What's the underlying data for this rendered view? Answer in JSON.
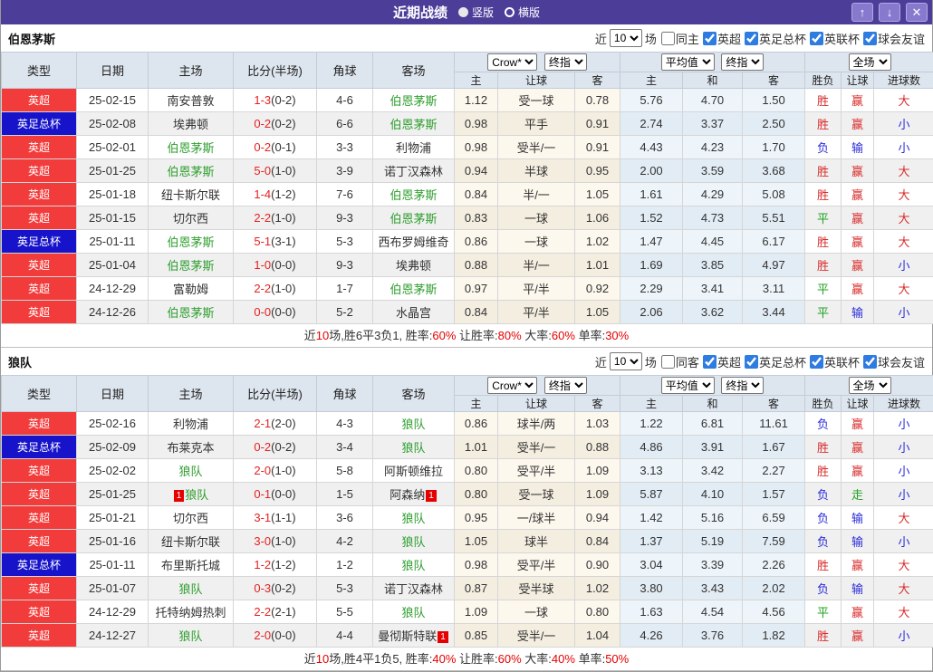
{
  "titlebar": {
    "title": "近期战绩",
    "radios": [
      {
        "label": "竖版",
        "selected": true
      },
      {
        "label": "横版",
        "selected": false
      }
    ],
    "icons": {
      "up": "↑",
      "down": "↓",
      "close": "✕"
    }
  },
  "colors": {
    "titlebar_bg": "#4c3d99",
    "league_red": "#f23b3b",
    "league_blue": "#1713ca",
    "team_green": "#2e9e2e",
    "score_red": "#e62222",
    "win_red": "#d92b2b",
    "lose_blue": "#2b2bd9",
    "draw_green": "#22a022"
  },
  "filters": {
    "near_label": "近",
    "count_value": "10",
    "unit_label": "场",
    "leagues": [
      "英超",
      "英足总杯",
      "英联杯",
      "球会友谊"
    ]
  },
  "table_header": {
    "static_cols": [
      "类型",
      "日期",
      "主场",
      "比分(半场)",
      "角球",
      "客场"
    ],
    "odds_selects": [
      "Crow*",
      "终指"
    ],
    "odds_cols": [
      "主",
      "让球",
      "客"
    ],
    "avg_selects": [
      "平均值",
      "终指"
    ],
    "avg_cols": [
      "主",
      "和",
      "客"
    ],
    "result_selects": [
      "全场"
    ],
    "result_cols": [
      "胜负",
      "让球",
      "进球数"
    ]
  },
  "red_card": {
    "label": "1"
  },
  "sections": [
    {
      "team": "伯恩茅斯",
      "same_venue_label": "同主",
      "rows": [
        {
          "league": "英超",
          "league_type": "red",
          "date": "25-02-15",
          "home": "南安普敦",
          "home_green": false,
          "home_card": false,
          "ft": "1-3",
          "ht": "(0-2)",
          "corner": "4-6",
          "away": "伯恩茅斯",
          "away_green": true,
          "away_card": false,
          "crow": [
            "1.12",
            "受一球",
            "0.78"
          ],
          "avg": [
            "5.76",
            "4.70",
            "1.50"
          ],
          "outcome": [
            "胜",
            "red"
          ],
          "handicap": [
            "赢",
            "red"
          ],
          "goals": [
            "大",
            "red"
          ]
        },
        {
          "league": "英足总杯",
          "league_type": "blue",
          "date": "25-02-08",
          "home": "埃弗顿",
          "home_green": false,
          "home_card": false,
          "ft": "0-2",
          "ht": "(0-2)",
          "corner": "6-6",
          "away": "伯恩茅斯",
          "away_green": true,
          "away_card": false,
          "crow": [
            "0.98",
            "平手",
            "0.91"
          ],
          "avg": [
            "2.74",
            "3.37",
            "2.50"
          ],
          "outcome": [
            "胜",
            "red"
          ],
          "handicap": [
            "赢",
            "red"
          ],
          "goals": [
            "小",
            "blue"
          ]
        },
        {
          "league": "英超",
          "league_type": "red",
          "date": "25-02-01",
          "home": "伯恩茅斯",
          "home_green": true,
          "home_card": false,
          "ft": "0-2",
          "ht": "(0-1)",
          "corner": "3-3",
          "away": "利物浦",
          "away_green": false,
          "away_card": false,
          "crow": [
            "0.98",
            "受半/一",
            "0.91"
          ],
          "avg": [
            "4.43",
            "4.23",
            "1.70"
          ],
          "outcome": [
            "负",
            "blue"
          ],
          "handicap": [
            "输",
            "blue"
          ],
          "goals": [
            "小",
            "blue"
          ]
        },
        {
          "league": "英超",
          "league_type": "red",
          "date": "25-01-25",
          "home": "伯恩茅斯",
          "home_green": true,
          "home_card": false,
          "ft": "5-0",
          "ht": "(1-0)",
          "corner": "3-9",
          "away": "诺丁汉森林",
          "away_green": false,
          "away_card": false,
          "crow": [
            "0.94",
            "半球",
            "0.95"
          ],
          "avg": [
            "2.00",
            "3.59",
            "3.68"
          ],
          "outcome": [
            "胜",
            "red"
          ],
          "handicap": [
            "赢",
            "red"
          ],
          "goals": [
            "大",
            "red"
          ]
        },
        {
          "league": "英超",
          "league_type": "red",
          "date": "25-01-18",
          "home": "纽卡斯尔联",
          "home_green": false,
          "home_card": false,
          "ft": "1-4",
          "ht": "(1-2)",
          "corner": "7-6",
          "away": "伯恩茅斯",
          "away_green": true,
          "away_card": false,
          "crow": [
            "0.84",
            "半/一",
            "1.05"
          ],
          "avg": [
            "1.61",
            "4.29",
            "5.08"
          ],
          "outcome": [
            "胜",
            "red"
          ],
          "handicap": [
            "赢",
            "red"
          ],
          "goals": [
            "大",
            "red"
          ]
        },
        {
          "league": "英超",
          "league_type": "red",
          "date": "25-01-15",
          "home": "切尔西",
          "home_green": false,
          "home_card": false,
          "ft": "2-2",
          "ht": "(1-0)",
          "corner": "9-3",
          "away": "伯恩茅斯",
          "away_green": true,
          "away_card": false,
          "crow": [
            "0.83",
            "一球",
            "1.06"
          ],
          "avg": [
            "1.52",
            "4.73",
            "5.51"
          ],
          "outcome": [
            "平",
            "green"
          ],
          "handicap": [
            "赢",
            "red"
          ],
          "goals": [
            "大",
            "red"
          ]
        },
        {
          "league": "英足总杯",
          "league_type": "blue",
          "date": "25-01-11",
          "home": "伯恩茅斯",
          "home_green": true,
          "home_card": false,
          "ft": "5-1",
          "ht": "(3-1)",
          "corner": "5-3",
          "away": "西布罗姆维奇",
          "away_green": false,
          "away_card": false,
          "crow": [
            "0.86",
            "一球",
            "1.02"
          ],
          "avg": [
            "1.47",
            "4.45",
            "6.17"
          ],
          "outcome": [
            "胜",
            "red"
          ],
          "handicap": [
            "赢",
            "red"
          ],
          "goals": [
            "大",
            "red"
          ]
        },
        {
          "league": "英超",
          "league_type": "red",
          "date": "25-01-04",
          "home": "伯恩茅斯",
          "home_green": true,
          "home_card": false,
          "ft": "1-0",
          "ht": "(0-0)",
          "corner": "9-3",
          "away": "埃弗顿",
          "away_green": false,
          "away_card": false,
          "crow": [
            "0.88",
            "半/一",
            "1.01"
          ],
          "avg": [
            "1.69",
            "3.85",
            "4.97"
          ],
          "outcome": [
            "胜",
            "red"
          ],
          "handicap": [
            "赢",
            "red"
          ],
          "goals": [
            "小",
            "blue"
          ]
        },
        {
          "league": "英超",
          "league_type": "red",
          "date": "24-12-29",
          "home": "富勒姆",
          "home_green": false,
          "home_card": false,
          "ft": "2-2",
          "ht": "(1-0)",
          "corner": "1-7",
          "away": "伯恩茅斯",
          "away_green": true,
          "away_card": false,
          "crow": [
            "0.97",
            "平/半",
            "0.92"
          ],
          "avg": [
            "2.29",
            "3.41",
            "3.11"
          ],
          "outcome": [
            "平",
            "green"
          ],
          "handicap": [
            "赢",
            "red"
          ],
          "goals": [
            "大",
            "red"
          ]
        },
        {
          "league": "英超",
          "league_type": "red",
          "date": "24-12-26",
          "home": "伯恩茅斯",
          "home_green": true,
          "home_card": false,
          "ft": "0-0",
          "ht": "(0-0)",
          "corner": "5-2",
          "away": "水晶宫",
          "away_green": false,
          "away_card": false,
          "crow": [
            "0.84",
            "平/半",
            "1.05"
          ],
          "avg": [
            "2.06",
            "3.62",
            "3.44"
          ],
          "outcome": [
            "平",
            "green"
          ],
          "handicap": [
            "输",
            "blue"
          ],
          "goals": [
            "小",
            "blue"
          ]
        }
      ],
      "summary": [
        {
          "text": "近",
          "red": false
        },
        {
          "text": "10",
          "red": true
        },
        {
          "text": "场,胜6平3负1, 胜率:",
          "red": false
        },
        {
          "text": "60%",
          "red": true
        },
        {
          "text": " 让胜率:",
          "red": false
        },
        {
          "text": "80%",
          "red": true
        },
        {
          "text": " 大率:",
          "red": false
        },
        {
          "text": "60%",
          "red": true
        },
        {
          "text": " 单率:",
          "red": false
        },
        {
          "text": "30%",
          "red": true
        }
      ]
    },
    {
      "team": "狼队",
      "same_venue_label": "同客",
      "rows": [
        {
          "league": "英超",
          "league_type": "red",
          "date": "25-02-16",
          "home": "利物浦",
          "home_green": false,
          "home_card": false,
          "ft": "2-1",
          "ht": "(2-0)",
          "corner": "4-3",
          "away": "狼队",
          "away_green": true,
          "away_card": false,
          "crow": [
            "0.86",
            "球半/两",
            "1.03"
          ],
          "avg": [
            "1.22",
            "6.81",
            "11.61"
          ],
          "outcome": [
            "负",
            "blue"
          ],
          "handicap": [
            "赢",
            "red"
          ],
          "goals": [
            "小",
            "blue"
          ]
        },
        {
          "league": "英足总杯",
          "league_type": "blue",
          "date": "25-02-09",
          "home": "布莱克本",
          "home_green": false,
          "home_card": false,
          "ft": "0-2",
          "ht": "(0-2)",
          "corner": "3-4",
          "away": "狼队",
          "away_green": true,
          "away_card": false,
          "crow": [
            "1.01",
            "受半/一",
            "0.88"
          ],
          "avg": [
            "4.86",
            "3.91",
            "1.67"
          ],
          "outcome": [
            "胜",
            "red"
          ],
          "handicap": [
            "赢",
            "red"
          ],
          "goals": [
            "小",
            "blue"
          ]
        },
        {
          "league": "英超",
          "league_type": "red",
          "date": "25-02-02",
          "home": "狼队",
          "home_green": true,
          "home_card": false,
          "ft": "2-0",
          "ht": "(1-0)",
          "corner": "5-8",
          "away": "阿斯顿维拉",
          "away_green": false,
          "away_card": false,
          "crow": [
            "0.80",
            "受平/半",
            "1.09"
          ],
          "avg": [
            "3.13",
            "3.42",
            "2.27"
          ],
          "outcome": [
            "胜",
            "red"
          ],
          "handicap": [
            "赢",
            "red"
          ],
          "goals": [
            "小",
            "blue"
          ]
        },
        {
          "league": "英超",
          "league_type": "red",
          "date": "25-01-25",
          "home": "狼队",
          "home_green": true,
          "home_card": true,
          "ft": "0-1",
          "ht": "(0-0)",
          "corner": "1-5",
          "away": "阿森纳",
          "away_green": false,
          "away_card": true,
          "crow": [
            "0.80",
            "受一球",
            "1.09"
          ],
          "avg": [
            "5.87",
            "4.10",
            "1.57"
          ],
          "outcome": [
            "负",
            "blue"
          ],
          "handicap": [
            "走",
            "green"
          ],
          "goals": [
            "小",
            "blue"
          ]
        },
        {
          "league": "英超",
          "league_type": "red",
          "date": "25-01-21",
          "home": "切尔西",
          "home_green": false,
          "home_card": false,
          "ft": "3-1",
          "ht": "(1-1)",
          "corner": "3-6",
          "away": "狼队",
          "away_green": true,
          "away_card": false,
          "crow": [
            "0.95",
            "一/球半",
            "0.94"
          ],
          "avg": [
            "1.42",
            "5.16",
            "6.59"
          ],
          "outcome": [
            "负",
            "blue"
          ],
          "handicap": [
            "输",
            "blue"
          ],
          "goals": [
            "大",
            "red"
          ]
        },
        {
          "league": "英超",
          "league_type": "red",
          "date": "25-01-16",
          "home": "纽卡斯尔联",
          "home_green": false,
          "home_card": false,
          "ft": "3-0",
          "ht": "(1-0)",
          "corner": "4-2",
          "away": "狼队",
          "away_green": true,
          "away_card": false,
          "crow": [
            "1.05",
            "球半",
            "0.84"
          ],
          "avg": [
            "1.37",
            "5.19",
            "7.59"
          ],
          "outcome": [
            "负",
            "blue"
          ],
          "handicap": [
            "输",
            "blue"
          ],
          "goals": [
            "小",
            "blue"
          ]
        },
        {
          "league": "英足总杯",
          "league_type": "blue",
          "date": "25-01-11",
          "home": "布里斯托城",
          "home_green": false,
          "home_card": false,
          "ft": "1-2",
          "ht": "(1-2)",
          "corner": "1-2",
          "away": "狼队",
          "away_green": true,
          "away_card": false,
          "crow": [
            "0.98",
            "受平/半",
            "0.90"
          ],
          "avg": [
            "3.04",
            "3.39",
            "2.26"
          ],
          "outcome": [
            "胜",
            "red"
          ],
          "handicap": [
            "赢",
            "red"
          ],
          "goals": [
            "大",
            "red"
          ]
        },
        {
          "league": "英超",
          "league_type": "red",
          "date": "25-01-07",
          "home": "狼队",
          "home_green": true,
          "home_card": false,
          "ft": "0-3",
          "ht": "(0-2)",
          "corner": "5-3",
          "away": "诺丁汉森林",
          "away_green": false,
          "away_card": false,
          "crow": [
            "0.87",
            "受半球",
            "1.02"
          ],
          "avg": [
            "3.80",
            "3.43",
            "2.02"
          ],
          "outcome": [
            "负",
            "blue"
          ],
          "handicap": [
            "输",
            "blue"
          ],
          "goals": [
            "大",
            "red"
          ]
        },
        {
          "league": "英超",
          "league_type": "red",
          "date": "24-12-29",
          "home": "托特纳姆热刺",
          "home_green": false,
          "home_card": false,
          "ft": "2-2",
          "ht": "(2-1)",
          "corner": "5-5",
          "away": "狼队",
          "away_green": true,
          "away_card": false,
          "crow": [
            "1.09",
            "一球",
            "0.80"
          ],
          "avg": [
            "1.63",
            "4.54",
            "4.56"
          ],
          "outcome": [
            "平",
            "green"
          ],
          "handicap": [
            "赢",
            "red"
          ],
          "goals": [
            "大",
            "red"
          ]
        },
        {
          "league": "英超",
          "league_type": "red",
          "date": "24-12-27",
          "home": "狼队",
          "home_green": true,
          "home_card": false,
          "ft": "2-0",
          "ht": "(0-0)",
          "corner": "4-4",
          "away": "曼彻斯特联",
          "away_green": false,
          "away_card": true,
          "crow": [
            "0.85",
            "受半/一",
            "1.04"
          ],
          "avg": [
            "4.26",
            "3.76",
            "1.82"
          ],
          "outcome": [
            "胜",
            "red"
          ],
          "handicap": [
            "赢",
            "red"
          ],
          "goals": [
            "小",
            "blue"
          ]
        }
      ],
      "summary": [
        {
          "text": "近",
          "red": false
        },
        {
          "text": "10",
          "red": true
        },
        {
          "text": "场,胜4平1负5, 胜率:",
          "red": false
        },
        {
          "text": "40%",
          "red": true
        },
        {
          "text": " 让胜率:",
          "red": false
        },
        {
          "text": "60%",
          "red": true
        },
        {
          "text": " 大率:",
          "red": false
        },
        {
          "text": "40%",
          "red": true
        },
        {
          "text": " 单率:",
          "red": false
        },
        {
          "text": "50%",
          "red": true
        }
      ]
    }
  ]
}
